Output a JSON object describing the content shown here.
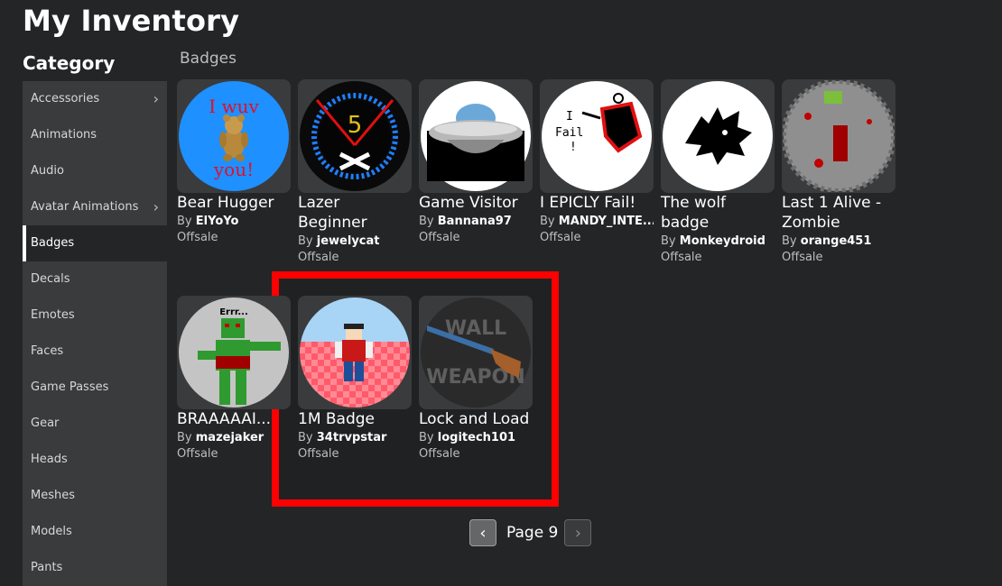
{
  "page": {
    "title": "My Inventory",
    "category_title": "Category",
    "section_title": "Badges"
  },
  "sidebar": {
    "items": [
      {
        "label": "Accessories",
        "has_chevron": true
      },
      {
        "label": "Animations"
      },
      {
        "label": "Audio"
      },
      {
        "label": "Avatar Animations",
        "has_chevron": true
      },
      {
        "label": "Badges",
        "active": true
      },
      {
        "label": "Decals"
      },
      {
        "label": "Emotes"
      },
      {
        "label": "Faces"
      },
      {
        "label": "Game Passes"
      },
      {
        "label": "Gear"
      },
      {
        "label": "Heads"
      },
      {
        "label": "Meshes"
      },
      {
        "label": "Models"
      },
      {
        "label": "Pants"
      }
    ]
  },
  "items": [
    {
      "name": "Bear Hugger",
      "by": "By",
      "creator": "ElYoYo",
      "price": "Offsale",
      "icon": "bear-hugger-badge-icon"
    },
    {
      "name": "Lazer Beginner",
      "by": "By",
      "creator": "jewelycat",
      "price": "Offsale",
      "icon": "lazer-beginner-badge-icon"
    },
    {
      "name": "Game Visitor",
      "by": "By",
      "creator": "Bannana97",
      "price": "Offsale",
      "icon": "ufo-badge-icon"
    },
    {
      "name": "I EPICLY Fail!",
      "by": "By",
      "creator": "MANDY_INTE...",
      "price": "Offsale",
      "icon": "epic-fail-badge-icon"
    },
    {
      "name": "The wolf badge",
      "by": "By",
      "creator": "Monkeydroid",
      "price": "Offsale",
      "icon": "wolf-badge-icon"
    },
    {
      "name": "Last 1 Alive - Zombie",
      "by": "By",
      "creator": "orange451",
      "price": "Offsale",
      "icon": "last-alive-badge-icon"
    },
    {
      "name": "BRAAAAAI...",
      "by": "By",
      "creator": "mazejaker",
      "price": "Offsale",
      "icon": "zombie-badge-icon",
      "icon_text": "Errr..."
    },
    {
      "name": "1M Badge",
      "by": "By",
      "creator": "34trvpstar",
      "price": "Offsale",
      "icon": "1m-badge-icon"
    },
    {
      "name": "Lock and Load",
      "by": "By",
      "creator": "logitech101",
      "price": "Offsale",
      "icon": "wall-weapon-badge-icon",
      "icon_text": [
        "WALL",
        "WEAPON"
      ]
    }
  ],
  "pager": {
    "label": "Page 9",
    "prev_icon": "chevron-left-icon",
    "next_icon": "chevron-right-icon"
  },
  "colors": {
    "background": "#232527",
    "sidebar": "#393b3d",
    "highlight": "#ff0000"
  }
}
